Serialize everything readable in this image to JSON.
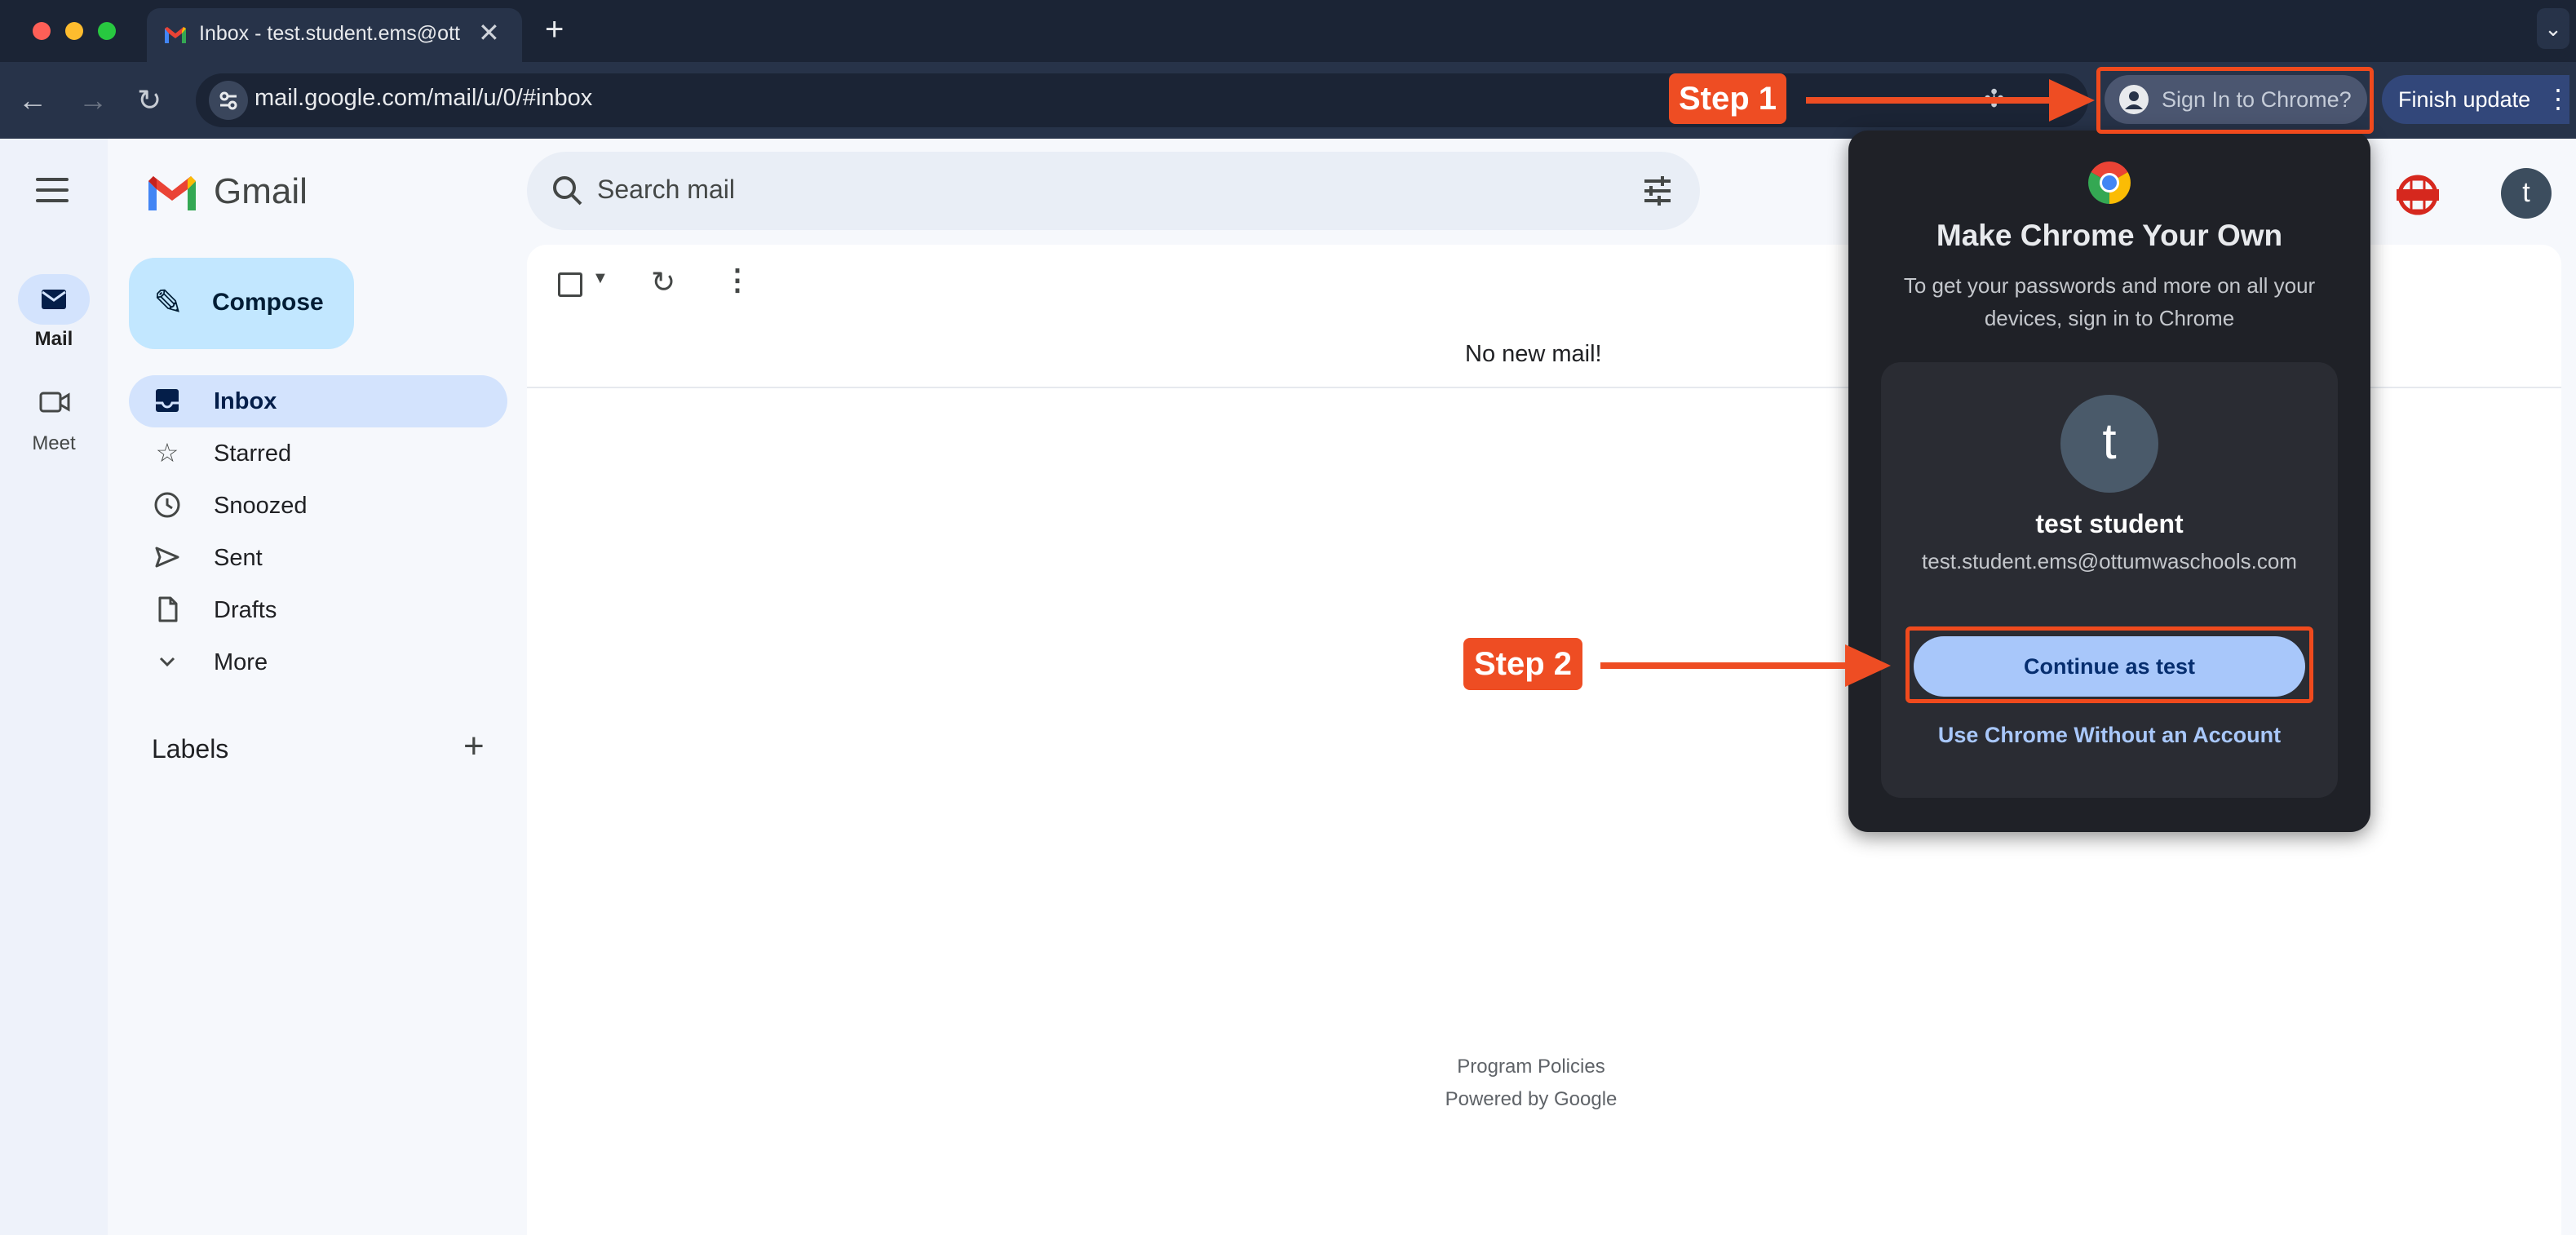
{
  "browser": {
    "tab_title": "Inbox - test.student.ems@ottumwaschools.com",
    "tab_close": "✕",
    "new_tab": "+",
    "tab_list": "⌄",
    "url": "mail.google.com/mail/u/0/#inbox",
    "back": "←",
    "forward": "→",
    "reload": "↻",
    "signin_label": "Sign In to Chrome?",
    "finish_update_label": "Finish update",
    "menu": "⋮"
  },
  "gmail": {
    "app_name": "Gmail",
    "rail": {
      "mail_label": "Mail",
      "meet_label": "Meet"
    },
    "compose_label": "Compose",
    "nav": [
      {
        "label": "Inbox"
      },
      {
        "label": "Starred"
      },
      {
        "label": "Snoozed"
      },
      {
        "label": "Sent"
      },
      {
        "label": "Drafts"
      },
      {
        "label": "More"
      }
    ],
    "labels_title": "Labels",
    "labels_add": "+",
    "search_placeholder": "Search mail",
    "no_mail": "No new mail!",
    "footer": {
      "policies": "Program Policies",
      "powered": "Powered by Google"
    },
    "avatar_letter": "t"
  },
  "popup": {
    "title": "Make Chrome Your Own",
    "description": "To get your passwords and more on all your devices, sign in to Chrome",
    "avatar_letter": "t",
    "account_name": "test student",
    "account_email": "test.student.ems@ottumwaschools.com",
    "continue_label": "Continue as test",
    "without_account_label": "Use Chrome Without an Account"
  },
  "annotations": {
    "step1": "Step 1",
    "step2": "Step 2",
    "color": "#ee4d23"
  }
}
